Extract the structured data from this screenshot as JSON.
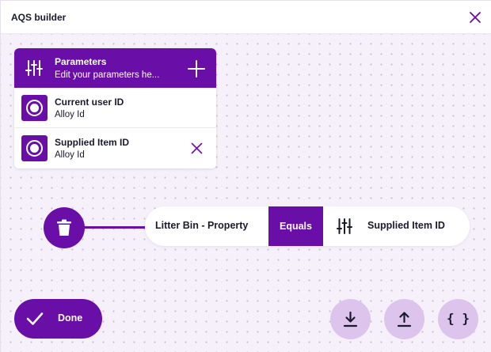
{
  "dialog": {
    "title": "AQS builder",
    "close_icon": "close-icon"
  },
  "parameters": {
    "title": "Parameters",
    "subtitle": "Edit your parameters he...",
    "icon": "sliders-icon",
    "add_icon": "plus-icon",
    "items": [
      {
        "name": "Current user ID",
        "type": "Alloy Id",
        "icon": "radio-target-icon",
        "removable": false
      },
      {
        "name": "Supplied Item ID",
        "type": "Alloy Id",
        "icon": "radio-target-icon",
        "removable": true
      }
    ]
  },
  "query": {
    "delete_icon": "trash-icon",
    "field": "Litter Bin - Property",
    "operator": "Equals",
    "value_icon": "sliders-icon",
    "value": "Supplied Item ID"
  },
  "footer": {
    "done_label": "Done",
    "done_icon": "check-icon",
    "download_icon": "download-icon",
    "upload_icon": "upload-icon",
    "json_label": "{ }"
  },
  "colors": {
    "accent": "#6a0ea8",
    "accent_light": "#dcc4ec",
    "canvas": "#f5f0fa",
    "text": "#1a1a2e"
  }
}
